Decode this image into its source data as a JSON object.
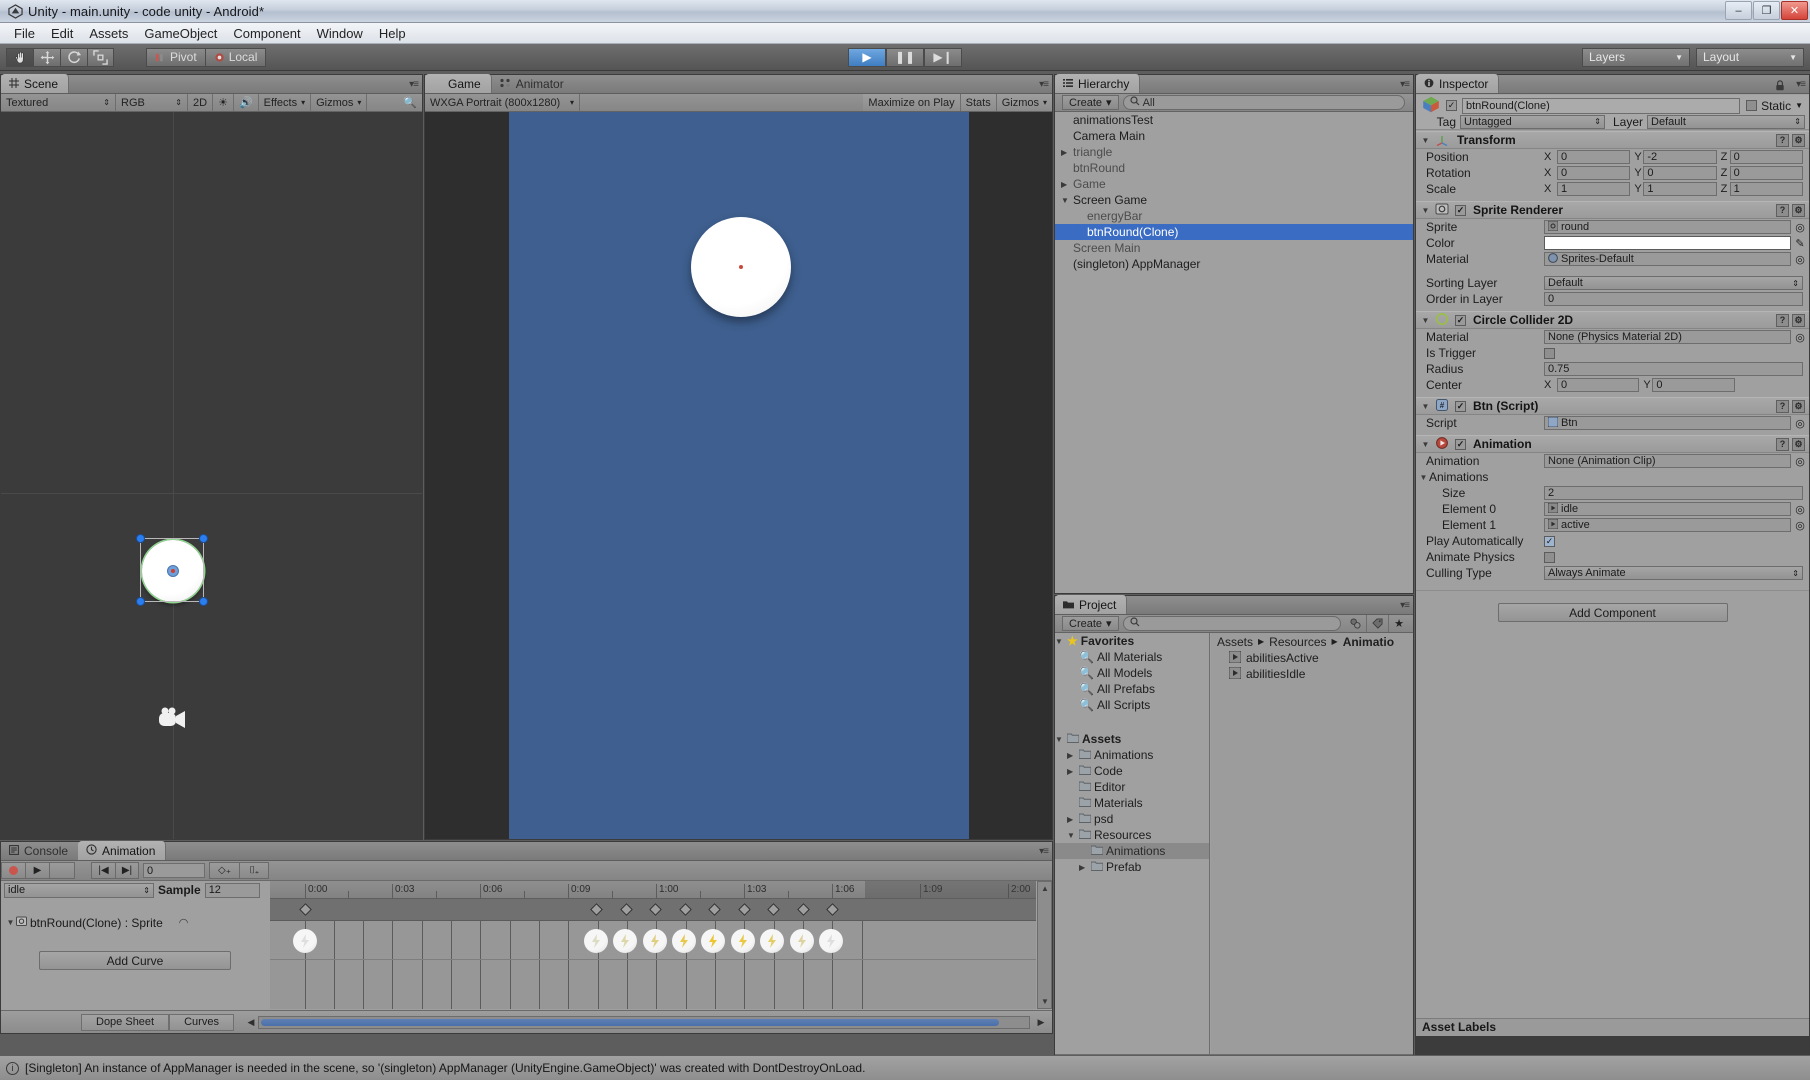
{
  "window": {
    "title": "Unity - main.unity - code unity - Android*",
    "app_icon": "unity-icon",
    "minimize": "–",
    "maximize": "❐",
    "close": "✕"
  },
  "menubar": {
    "items": [
      "File",
      "Edit",
      "Assets",
      "GameObject",
      "Component",
      "Window",
      "Help"
    ]
  },
  "toolbar": {
    "tools": [
      {
        "name": "hand-tool",
        "glyph": "✋",
        "active": true
      },
      {
        "name": "move-tool",
        "glyph": "✥",
        "active": false
      },
      {
        "name": "rotate-tool",
        "glyph": "⟳",
        "active": false
      },
      {
        "name": "scale-tool",
        "glyph": "⛶",
        "active": false
      }
    ],
    "pivot_label": "Pivot",
    "local_label": "Local",
    "play_label": "▶",
    "pause_label": "❚❚",
    "step_label": "▶❙",
    "layers_label": "Layers",
    "layout_label": "Layout"
  },
  "scene_panel": {
    "tab": "Scene",
    "tab_icon": "grid-icon",
    "draw_mode": "Textured",
    "color_mode": "RGB",
    "mode_2d": "2D",
    "light_icon": "sun-icon",
    "audio_icon": "speaker-icon",
    "effects": "Effects",
    "gizmos": "Gizmos"
  },
  "game_panel": {
    "tabs": [
      {
        "label": "Game",
        "icon": "game-icon",
        "active": true
      },
      {
        "label": "Animator",
        "icon": "animator-icon",
        "active": false
      }
    ],
    "aspect": "WXGA Portrait (800x1280)",
    "maximize_on_play": "Maximize on Play",
    "stats": "Stats",
    "gizmos": "Gizmos"
  },
  "hierarchy": {
    "tab": "Hierarchy",
    "tab_icon": "hierarchy-icon",
    "create_label": "Create",
    "search_placeholder": "All",
    "search_icon": "search-icon",
    "items": [
      {
        "label": "animationsTest",
        "indent": 1,
        "arrow": "",
        "dim": false,
        "selected": false
      },
      {
        "label": "Camera Main",
        "indent": 1,
        "arrow": "",
        "dim": false,
        "selected": false
      },
      {
        "label": "triangle",
        "indent": 1,
        "arrow": "▶",
        "dim": true,
        "selected": false
      },
      {
        "label": "btnRound",
        "indent": 1,
        "arrow": "",
        "dim": true,
        "selected": false
      },
      {
        "label": "Game",
        "indent": 1,
        "arrow": "▶",
        "dim": true,
        "selected": false
      },
      {
        "label": "Screen Game",
        "indent": 1,
        "arrow": "▼",
        "dim": false,
        "selected": false
      },
      {
        "label": "energyBar",
        "indent": 2,
        "arrow": "",
        "dim": true,
        "selected": false
      },
      {
        "label": "btnRound(Clone)",
        "indent": 2,
        "arrow": "",
        "dim": false,
        "selected": true
      },
      {
        "label": "Screen Main",
        "indent": 1,
        "arrow": "",
        "dim": true,
        "selected": false
      },
      {
        "label": "(singleton) AppManager",
        "indent": 1,
        "arrow": "",
        "dim": false,
        "selected": false
      }
    ]
  },
  "project": {
    "tab": "Project",
    "tab_icon": "folder-icon",
    "create_label": "Create",
    "search_placeholder": "",
    "tree": [
      {
        "label": "Favorites",
        "indent": 0,
        "arrow": "▼",
        "icon": "star-icon",
        "bold": true,
        "selected": false
      },
      {
        "label": "All Materials",
        "indent": 1,
        "arrow": "",
        "icon": "search-icon",
        "bold": false,
        "selected": false
      },
      {
        "label": "All Models",
        "indent": 1,
        "arrow": "",
        "icon": "search-icon",
        "bold": false,
        "selected": false
      },
      {
        "label": "All Prefabs",
        "indent": 1,
        "arrow": "",
        "icon": "search-icon",
        "bold": false,
        "selected": false
      },
      {
        "label": "All Scripts",
        "indent": 1,
        "arrow": "",
        "icon": "search-icon",
        "bold": false,
        "selected": false
      },
      {
        "label": "",
        "indent": 0,
        "arrow": "",
        "icon": "",
        "bold": false,
        "selected": false
      },
      {
        "label": "Assets",
        "indent": 0,
        "arrow": "▼",
        "icon": "folder-icon",
        "bold": true,
        "selected": false
      },
      {
        "label": "Animations",
        "indent": 1,
        "arrow": "▶",
        "icon": "folder-icon",
        "bold": false,
        "selected": false
      },
      {
        "label": "Code",
        "indent": 1,
        "arrow": "▶",
        "icon": "folder-icon",
        "bold": false,
        "selected": false
      },
      {
        "label": "Editor",
        "indent": 1,
        "arrow": "",
        "icon": "folder-icon",
        "bold": false,
        "selected": false
      },
      {
        "label": "Materials",
        "indent": 1,
        "arrow": "",
        "icon": "folder-icon",
        "bold": false,
        "selected": false
      },
      {
        "label": "psd",
        "indent": 1,
        "arrow": "▶",
        "icon": "folder-icon",
        "bold": false,
        "selected": false
      },
      {
        "label": "Resources",
        "indent": 1,
        "arrow": "▼",
        "icon": "folder-icon",
        "bold": false,
        "selected": false
      },
      {
        "label": "Animations",
        "indent": 2,
        "arrow": "",
        "icon": "folder-icon",
        "bold": false,
        "selected": true
      },
      {
        "label": "Prefab",
        "indent": 2,
        "arrow": "▶",
        "icon": "folder-icon",
        "bold": false,
        "selected": false
      }
    ],
    "breadcrumb": [
      "Assets",
      "Resources",
      "Animatio"
    ],
    "contents": [
      {
        "label": "abilitiesActive",
        "icon": "animation-clip-icon"
      },
      {
        "label": "abilitiesIdle",
        "icon": "animation-clip-icon"
      }
    ]
  },
  "inspector": {
    "tab": "Inspector",
    "tab_icon": "info-icon",
    "lock_icon": "lock-icon",
    "object_name": "btnRound(Clone)",
    "enabled": true,
    "static_label": "Static",
    "tag_label": "Tag",
    "tag_value": "Untagged",
    "layer_label": "Layer",
    "layer_value": "Default",
    "add_component_label": "Add Component",
    "asset_labels_title": "Asset Labels",
    "components": [
      {
        "name": "Transform",
        "icon": "transform-icon",
        "has_checkbox": false,
        "rows": [
          {
            "label": "Position",
            "type": "vector3",
            "x": "0",
            "y": "-2",
            "z": "0"
          },
          {
            "label": "Rotation",
            "type": "vector3",
            "x": "0",
            "y": "0",
            "z": "0"
          },
          {
            "label": "Scale",
            "type": "vector3",
            "x": "1",
            "y": "1",
            "z": "1"
          }
        ]
      },
      {
        "name": "Sprite Renderer",
        "icon": "sprite-renderer-icon",
        "has_checkbox": true,
        "checked": true,
        "rows": [
          {
            "label": "Sprite",
            "type": "object",
            "value": "round",
            "obj_icon": "sprite-icon"
          },
          {
            "label": "Color",
            "type": "color",
            "value": "#ffffff"
          },
          {
            "label": "Material",
            "type": "object",
            "value": "Sprites-Default",
            "obj_icon": "material-icon"
          },
          {
            "label": "",
            "type": "spacer"
          },
          {
            "label": "Sorting Layer",
            "type": "popup",
            "value": "Default"
          },
          {
            "label": "Order in Layer",
            "type": "text",
            "value": "0"
          }
        ]
      },
      {
        "name": "Circle Collider 2D",
        "icon": "circle-collider-icon",
        "has_checkbox": true,
        "checked": true,
        "rows": [
          {
            "label": "Material",
            "type": "object",
            "value": "None (Physics Material 2D)"
          },
          {
            "label": "Is Trigger",
            "type": "checkbox",
            "checked": false
          },
          {
            "label": "Radius",
            "type": "text",
            "value": "0.75"
          },
          {
            "label": "Center",
            "type": "vector2",
            "x": "0",
            "y": "0"
          }
        ]
      },
      {
        "name": "Btn (Script)",
        "icon": "script-icon",
        "has_checkbox": true,
        "checked": true,
        "rows": [
          {
            "label": "Script",
            "type": "object",
            "value": "Btn",
            "obj_icon": "script-icon"
          }
        ]
      },
      {
        "name": "Animation",
        "icon": "animation-icon",
        "has_checkbox": true,
        "checked": true,
        "rows": [
          {
            "label": "Animation",
            "type": "object",
            "value": "None (Animation Clip)"
          },
          {
            "label": "Animations",
            "type": "foldout",
            "value": ""
          },
          {
            "label": "Size",
            "type": "text",
            "value": "2",
            "indent": 2
          },
          {
            "label": "Element 0",
            "type": "object",
            "value": "idle",
            "obj_icon": "animation-clip-icon",
            "indent": 2
          },
          {
            "label": "Element 1",
            "type": "object",
            "value": "active",
            "obj_icon": "animation-clip-icon",
            "indent": 2
          },
          {
            "label": "Play Automatically",
            "type": "checkbox",
            "checked": true
          },
          {
            "label": "Animate Physics",
            "type": "checkbox",
            "checked": false
          },
          {
            "label": "Culling Type",
            "type": "popup",
            "value": "Always Animate"
          }
        ]
      }
    ]
  },
  "animation_panel": {
    "tabs": [
      {
        "label": "Console",
        "icon": "console-icon",
        "active": false
      },
      {
        "label": "Animation",
        "icon": "clock-icon",
        "active": true
      }
    ],
    "record_icon": "record-icon",
    "play_icon": "play-icon",
    "prev_key_icon": "prev-keyframe-icon",
    "next_key_icon": "next-keyframe-icon",
    "frame_value": "0",
    "add_keyframe_icon": "add-keyframe-icon",
    "add_event_icon": "add-event-icon",
    "clip_name": "idle",
    "sample_label": "Sample",
    "sample_value": "12",
    "curve_row_label": "btnRound(Clone) : Sprite",
    "add_curve_label": "Add Curve",
    "footer_tabs": [
      "Dope Sheet",
      "Curves"
    ],
    "ruler_labels": [
      "0:00",
      "0:03",
      "0:06",
      "0:09",
      "1:00",
      "1:03",
      "1:06",
      "1:09",
      "2:00"
    ],
    "keyframe_times": [
      0,
      9,
      10,
      11,
      12,
      13,
      14,
      15,
      16,
      17
    ],
    "sprite_keys": 10
  },
  "statusbar": {
    "icon": "info-icon",
    "message": "[Singleton] An instance of AppManager is needed in the scene, so '(singleton) AppManager (UnityEngine.GameObject)' was created with DontDestroyOnLoad."
  },
  "colors": {
    "panel_bg": "#a0a0a0",
    "selection": "#3a6cc4",
    "game_bg": "#3e5f8f",
    "scene_bg": "#3b3b3b"
  }
}
